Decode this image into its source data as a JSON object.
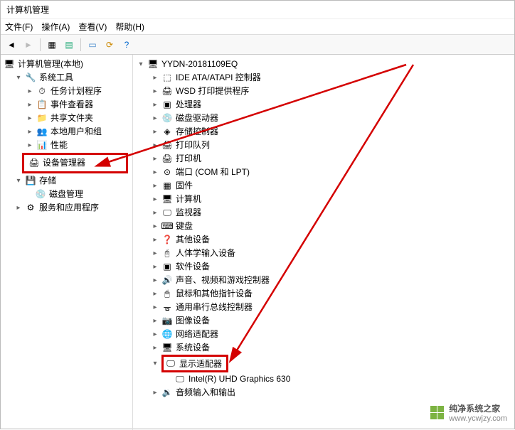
{
  "window": {
    "title": "计算机管理"
  },
  "menu": {
    "file": "文件(F)",
    "action": "操作(A)",
    "view": "查看(V)",
    "help": "帮助(H)"
  },
  "toolbar_icons": [
    "back",
    "forward",
    "up",
    "prop",
    "window",
    "refresh",
    "help"
  ],
  "left_tree": {
    "root": "计算机管理(本地)",
    "system_tools": "系统工具",
    "task_scheduler": "任务计划程序",
    "event_viewer": "事件查看器",
    "shared_folders": "共享文件夹",
    "local_users": "本地用户和组",
    "performance": "性能",
    "device_manager": "设备管理器",
    "storage": "存储",
    "disk_mgmt": "磁盘管理",
    "services_apps": "服务和应用程序"
  },
  "right_tree": {
    "root": "YYDN-20181109EQ",
    "ide": "IDE ATA/ATAPI 控制器",
    "wsd": "WSD 打印提供程序",
    "cpu": "处理器",
    "disk_drives": "磁盘驱动器",
    "storage_ctrl": "存储控制器",
    "print_queue": "打印队列",
    "printers": "打印机",
    "ports": "端口 (COM 和 LPT)",
    "firmware": "固件",
    "computer": "计算机",
    "monitors": "监视器",
    "keyboard": "键盘",
    "other_devices": "其他设备",
    "hid": "人体学输入设备",
    "software_dev": "软件设备",
    "sound": "声音、视频和游戏控制器",
    "mouse": "鼠标和其他指针设备",
    "usb": "通用串行总线控制器",
    "image": "图像设备",
    "network": "网络适配器",
    "system": "系统设备",
    "display": "显示适配器",
    "display_child": "Intel(R) UHD Graphics 630",
    "audio_io": "音频输入和输出"
  },
  "watermark": {
    "brand": "纯净系统之家",
    "url": "www.ycwjzy.com"
  },
  "colors": {
    "highlight": "#d40000",
    "arrow": "#d40000"
  }
}
